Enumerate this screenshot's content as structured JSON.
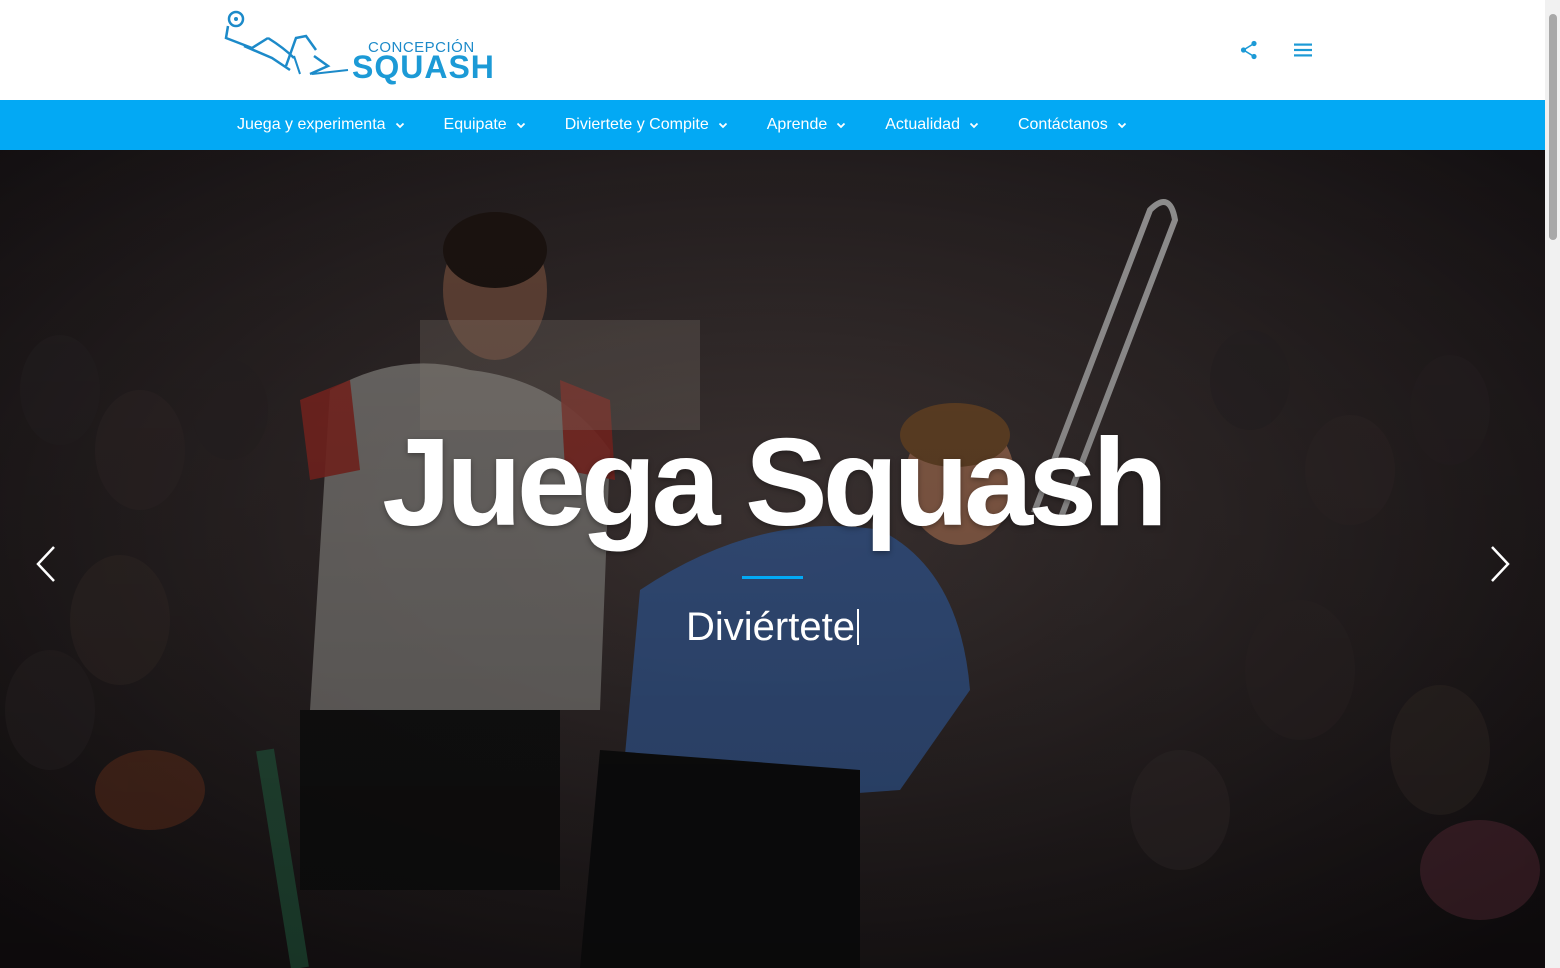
{
  "header": {
    "logo": {
      "line1": "CONCEPCIÓN",
      "line2": "SQUASH"
    },
    "share_icon": "share-icon",
    "menu_icon": "hamburger-menu-icon"
  },
  "nav": {
    "items": [
      {
        "label": "Juega y experimenta"
      },
      {
        "label": "Equipate"
      },
      {
        "label": "Diviertete y Compite"
      },
      {
        "label": "Aprende"
      },
      {
        "label": "Actualidad"
      },
      {
        "label": "Contáctanos"
      }
    ]
  },
  "hero": {
    "title": "Juega Squash",
    "subtitle": "Diviértete",
    "prev_icon": "chevron-left-icon",
    "next_icon": "chevron-right-icon"
  },
  "colors": {
    "nav_bg": "#03a9f4",
    "accent": "#03a9f4",
    "logo_blue": "#1c9ad6"
  }
}
